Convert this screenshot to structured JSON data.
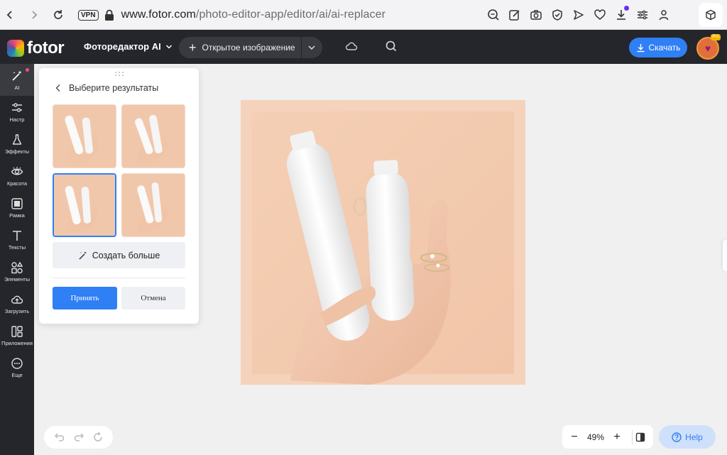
{
  "browser": {
    "vpn_label": "VPN",
    "url_domain": "www.fotor.com",
    "url_path": "/photo-editor-app/editor/ai/ai-replacer"
  },
  "header": {
    "logo_text": "fotor",
    "editor_name": "Фоторедактор AI",
    "open_image_label": "Открытое изображение",
    "download_label": "Скачать",
    "pro_badge": "Pro"
  },
  "tools": [
    {
      "label": "AI",
      "icon": "magic-wand-icon"
    },
    {
      "label": "Настр",
      "icon": "sliders-icon"
    },
    {
      "label": "Эффекты",
      "icon": "flask-icon"
    },
    {
      "label": "Красота",
      "icon": "eye-icon"
    },
    {
      "label": "Рамка",
      "icon": "frame-icon"
    },
    {
      "label": "Тексты",
      "icon": "text-icon"
    },
    {
      "label": "Элементы",
      "icon": "shapes-icon"
    },
    {
      "label": "Загрузить",
      "icon": "upload-cloud-icon"
    },
    {
      "label": "Приложения",
      "icon": "apps-icon"
    },
    {
      "label": "Еще",
      "icon": "more-icon"
    }
  ],
  "panel": {
    "title": "Выберите результаты",
    "generate_more_label": "Создать больше",
    "accept_label": "Принять",
    "cancel_label": "Отмена",
    "selected_index": 2
  },
  "zoom": {
    "value": "49%",
    "minus": "−",
    "plus": "+"
  },
  "help_label": "Help",
  "colors": {
    "accent": "#2f7ff5",
    "header_bg": "#25262b",
    "canvas_bg": "#f0f0f0",
    "photo_bg": "#f3cdb2"
  }
}
